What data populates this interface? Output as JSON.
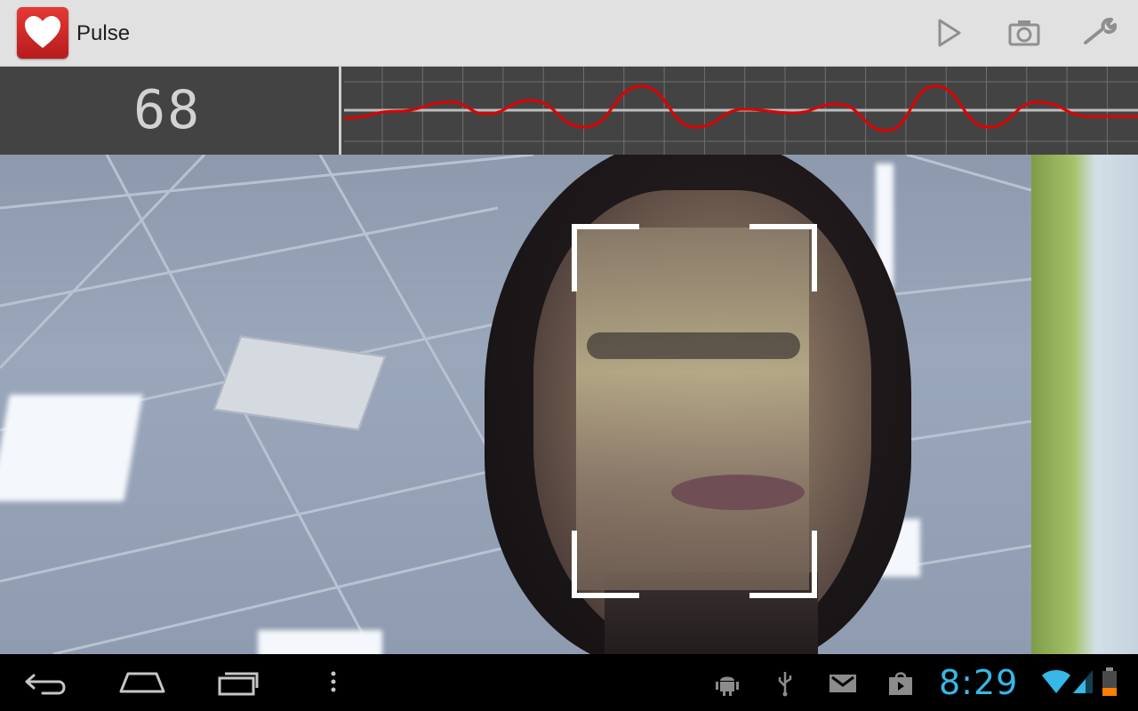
{
  "app": {
    "title": "Pulse",
    "icon": "heart-icon",
    "accent_color": "#d32f2f"
  },
  "action_bar": {
    "actions": [
      {
        "name": "play",
        "icon": "play-icon"
      },
      {
        "name": "camera",
        "icon": "camera-icon"
      },
      {
        "name": "settings",
        "icon": "wrench-icon"
      }
    ]
  },
  "monitor": {
    "bpm": "68",
    "waveform_color": "#e00000"
  },
  "status_bar": {
    "time": "8:29",
    "time_color": "#36b8e8",
    "icons": [
      "android-debug-icon",
      "usb-icon",
      "gmail-icon",
      "store-icon",
      "wifi-icon",
      "signal-icon",
      "battery-icon"
    ]
  },
  "navigation": {
    "buttons": [
      "back",
      "home",
      "recent-apps",
      "menu"
    ]
  }
}
